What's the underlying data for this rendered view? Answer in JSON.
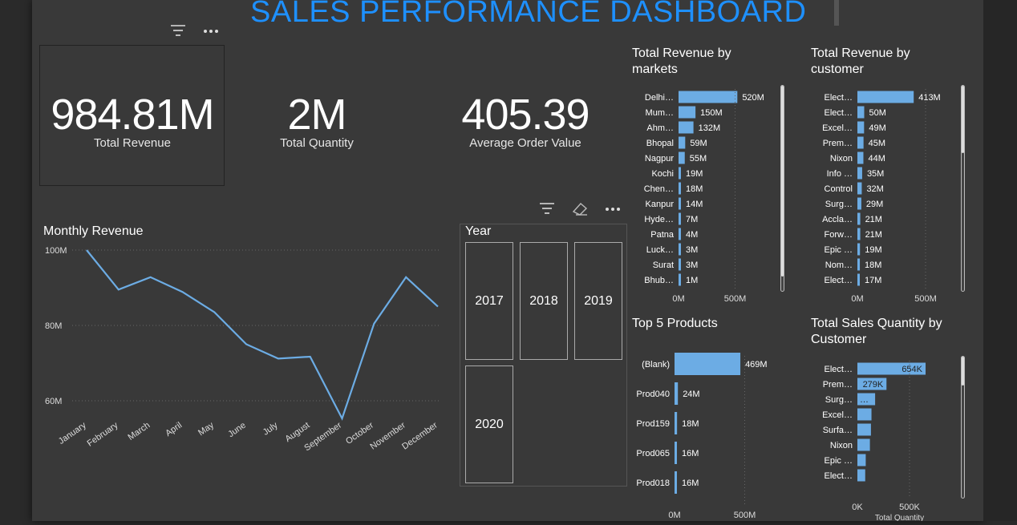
{
  "header": {
    "title": "SALES PERFORMANCE DASHBOARD"
  },
  "kpis": [
    {
      "value": "984.81M",
      "label": "Total Revenue"
    },
    {
      "value": "2M",
      "label": "Total Quantity"
    },
    {
      "value": "405.39",
      "label": "Average Order Value"
    }
  ],
  "icons": {
    "filter": "filter-icon",
    "more": "more-options-icon",
    "eraser": "eraser-icon"
  },
  "colors": {
    "bar": "#6cace4",
    "line": "#6cace4",
    "title": "#1e90ff",
    "background": "#393939"
  },
  "slicer": {
    "title": "Year",
    "options": [
      "2017",
      "2018",
      "2019",
      "2020"
    ]
  },
  "chart_data": [
    {
      "id": "monthly",
      "type": "line",
      "title": "Monthly Revenue",
      "categories": [
        "January",
        "February",
        "March",
        "April",
        "May",
        "June",
        "July",
        "August",
        "September",
        "October",
        "November",
        "December"
      ],
      "values": [
        100,
        89.5,
        92.8,
        88.9,
        83.5,
        75.0,
        71.2,
        71.7,
        55.3,
        80.5,
        92.8,
        85.0
      ],
      "yticks": [
        "60M",
        "80M",
        "100M"
      ],
      "ylim": [
        60,
        100
      ],
      "grid": true
    },
    {
      "id": "markets",
      "type": "bar",
      "title": "Total Revenue by markets",
      "categories": [
        "Delhi…",
        "Mum…",
        "Ahm…",
        "Bhopal",
        "Nagpur",
        "Kochi",
        "Chen…",
        "Kanpur",
        "Hyde…",
        "Patna",
        "Luck…",
        "Surat",
        "Bhub…"
      ],
      "values": [
        520,
        150,
        132,
        59,
        55,
        19,
        18,
        14,
        7,
        4,
        3,
        3,
        1
      ],
      "labels": [
        "520M",
        "150M",
        "132M",
        "59M",
        "55M",
        "19M",
        "18M",
        "14M",
        "7M",
        "4M",
        "3M",
        "3M",
        "1M"
      ],
      "xticks": [
        "0M",
        "500M"
      ],
      "xlim": [
        0,
        500
      ]
    },
    {
      "id": "customers",
      "type": "bar",
      "title": "Total Revenue by customer",
      "categories": [
        "Elect…",
        "Elect…",
        "Excel…",
        "Prem…",
        "Nixon",
        "Info …",
        "Control",
        "Surg…",
        "Accla…",
        "Forw…",
        "Epic …",
        "Nom…",
        "Elect…"
      ],
      "values": [
        413,
        50,
        49,
        45,
        44,
        35,
        32,
        29,
        21,
        21,
        19,
        18,
        17
      ],
      "labels": [
        "413M",
        "50M",
        "49M",
        "45M",
        "44M",
        "35M",
        "32M",
        "29M",
        "21M",
        "21M",
        "19M",
        "18M",
        "17M"
      ],
      "xticks": [
        "0M",
        "500M"
      ],
      "xlim": [
        0,
        500
      ]
    },
    {
      "id": "products",
      "type": "bar",
      "title": "Top 5 Products",
      "categories": [
        "(Blank)",
        "Prod040",
        "Prod159",
        "Prod065",
        "Prod018"
      ],
      "values": [
        469,
        24,
        18,
        16,
        16
      ],
      "labels": [
        "469M",
        "24M",
        "18M",
        "16M",
        "16M"
      ],
      "xticks": [
        "0M",
        "500M"
      ],
      "xlim": [
        0,
        500
      ]
    },
    {
      "id": "quantity",
      "type": "bar",
      "title": "Total Sales Quantity by Customer",
      "categories": [
        "Elect…",
        "Prem…",
        "Surg…",
        "Excel…",
        "Surfa…",
        "Nixon",
        "Epic …",
        "Elect…"
      ],
      "values": [
        654,
        279,
        170,
        135,
        130,
        120,
        80,
        75
      ],
      "labels": [
        "654K",
        "279K",
        "…",
        "",
        "",
        "",
        "",
        ""
      ],
      "xticks": [
        "0K",
        "500K"
      ],
      "xlim": [
        0,
        500
      ],
      "xlabel": "Total Quantity"
    }
  ]
}
